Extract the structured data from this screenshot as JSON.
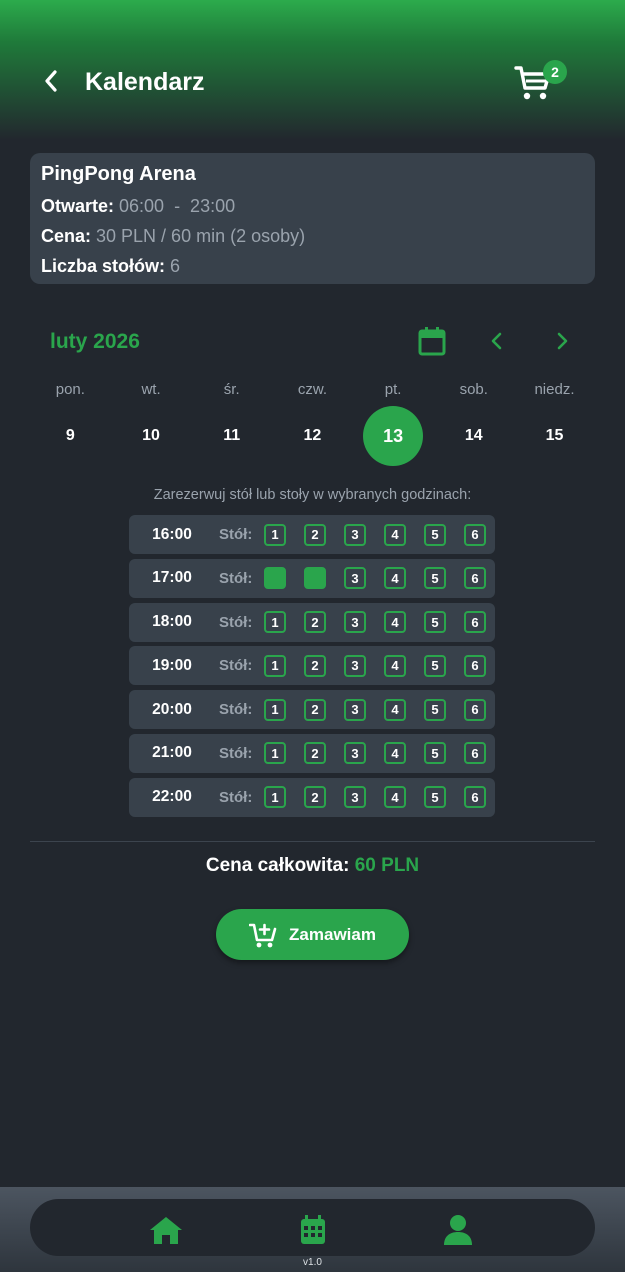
{
  "header": {
    "title": "Kalendarz",
    "cart_count": "2"
  },
  "venue": {
    "name": "PingPong Arena",
    "open_label": "Otwarte:",
    "open_value": " 06:00  -  23:00",
    "price_label": "Cena:",
    "price_value": " 30 PLN / 60 min (2 osoby)",
    "tables_label": "Liczba stołów:",
    "tables_value": " 6"
  },
  "calendar": {
    "month": "luty 2026",
    "weekdays": [
      "pon.",
      "wt.",
      "śr.",
      "czw.",
      "pt.",
      "sob.",
      "niedz."
    ],
    "days": [
      "9",
      "10",
      "11",
      "12",
      "13",
      "14",
      "15"
    ],
    "selected_day": "13"
  },
  "hint": "Zarezerwuj stół lub stoły w wybranych godzinach:",
  "slots": {
    "table_label": "Stół:",
    "tables": [
      "1",
      "2",
      "3",
      "4",
      "5",
      "6"
    ],
    "times": [
      "16:00",
      "17:00",
      "18:00",
      "19:00",
      "20:00",
      "21:00",
      "22:00"
    ],
    "selected": [
      [],
      [
        "1",
        "2"
      ],
      [],
      [],
      [],
      [],
      []
    ]
  },
  "total": {
    "label": "Cena całkowita:",
    "value": "60 PLN"
  },
  "order_button": "Zamawiam",
  "nav": {
    "items": [
      "home-icon",
      "calendar-icon",
      "user-icon"
    ],
    "version": "v1.0"
  },
  "colors": {
    "accent": "#2aa54c",
    "background": "#22272e",
    "card": "#38414b",
    "muted": "#9aa3ad"
  }
}
